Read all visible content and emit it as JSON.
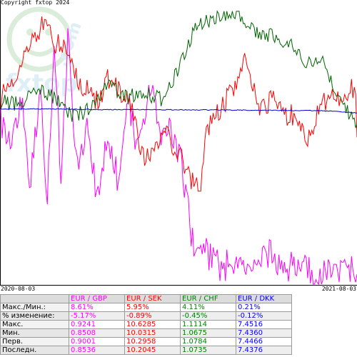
{
  "copyright": "Copyright fxtop 2024",
  "chart_data": {
    "type": "line",
    "x_start": "2020-08-03",
    "x_end": "2021-08-03",
    "grid": false,
    "series": [
      {
        "name": "EUR / GBP",
        "color": "#ff00ff",
        "start": 0.9001,
        "end": 0.8536,
        "max": 0.9241,
        "min": 0.8508,
        "max_pct": 8.61,
        "change_pct": -5.17
      },
      {
        "name": "EUR / SEK",
        "color": "#ff0000",
        "start": 10.2958,
        "end": 10.2045,
        "max": 10.6285,
        "min": 10.0315,
        "max_pct": 5.95,
        "change_pct": -0.89
      },
      {
        "name": "EUR / CHF",
        "color": "#006400",
        "start": 1.0784,
        "end": 1.0735,
        "max": 1.1114,
        "min": 1.0675,
        "max_pct": 4.11,
        "change_pct": -0.45
      },
      {
        "name": "EUR / DKK",
        "color": "#0000cc",
        "start": 7.4466,
        "end": 7.4376,
        "max": 7.4516,
        "min": 7.436,
        "max_pct": 0.21,
        "change_pct": -0.12
      }
    ]
  },
  "table": {
    "header_blank": "",
    "row_labels": [
      "Макс./Мин.:",
      "% изменение:",
      "Макс.",
      "Мин.",
      "Перв.",
      "Последн."
    ],
    "columns": [
      {
        "name": "EUR / GBP",
        "color": "#ff00ff",
        "values": [
          "8.61%",
          "-5.17%",
          "0.9241",
          "0.8508",
          "0.9001",
          "0.8536"
        ]
      },
      {
        "name": "EUR / SEK",
        "color": "#ff0000",
        "values": [
          "5.95%",
          "-0.89%",
          "10.6285",
          "10.0315",
          "10.2958",
          "10.2045"
        ]
      },
      {
        "name": "EUR / CHF",
        "color": "#008000",
        "values": [
          "4.11%",
          "-0.45%",
          "1.1114",
          "1.0675",
          "1.0784",
          "1.0735"
        ]
      },
      {
        "name": "EUR / DKK",
        "color": "#0000ff",
        "values": [
          "0.21%",
          "-0.12%",
          "7.4516",
          "7.4360",
          "7.4466",
          "7.4376"
        ]
      }
    ]
  }
}
